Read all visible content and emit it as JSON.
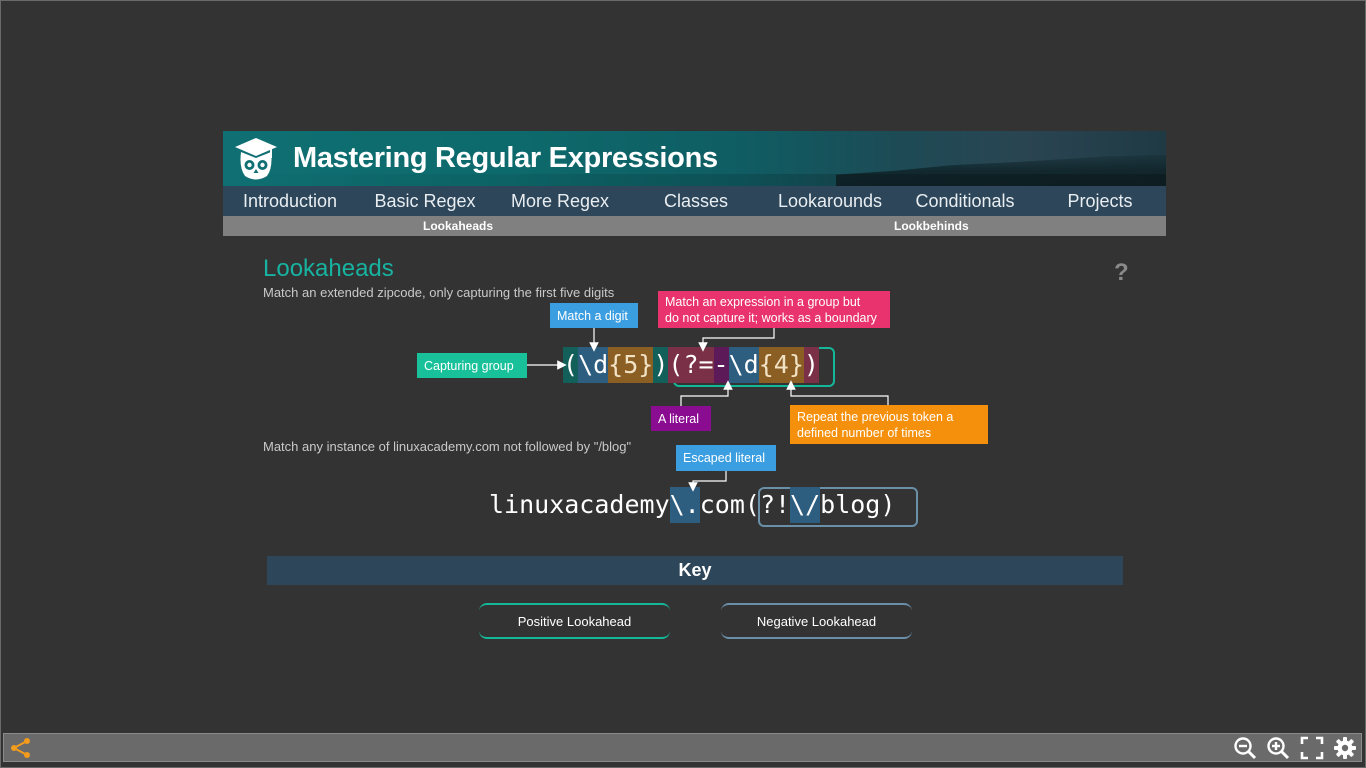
{
  "header": {
    "title": "Mastering Regular Expressions"
  },
  "nav": {
    "items": [
      "Introduction",
      "Basic Regex",
      "More Regex",
      "Classes",
      "Lookarounds",
      "Conditionals",
      "Projects"
    ],
    "sub_items": [
      "Lookaheads",
      "Lookbehinds"
    ]
  },
  "content": {
    "title": "Lookaheads",
    "help": "?",
    "example1": {
      "description": "Match an extended zipcode, only capturing the first five digits",
      "tokens": [
        "(",
        "\\d",
        "{5}",
        ")",
        "(?=",
        "-",
        "\\d",
        "{4}",
        ")"
      ],
      "callouts": {
        "digit": "Match a digit",
        "lookahead_line1": "Match an expression in a group but",
        "lookahead_line2": "do not capture it; works as a boundary",
        "group": "Capturing group",
        "literal": "A literal",
        "repeat_line1": "Repeat the previous token a",
        "repeat_line2": "defined number of times"
      }
    },
    "example2": {
      "description": "Match any instance of linuxacademy.com not followed by \"/blog\"",
      "tokens": [
        "linuxacademy",
        "\\.",
        "com",
        "(?!",
        "\\/",
        "blog)"
      ],
      "callouts": {
        "escaped": "Escaped literal"
      }
    },
    "key": {
      "title": "Key",
      "positive": "Positive Lookahead",
      "negative": "Negative Lookahead"
    }
  },
  "colors": {
    "accent_teal": "#17b3a0",
    "nav_bg": "#2d4659",
    "callout_blue": "#3b9ee0",
    "callout_pink": "#e8336e",
    "callout_green": "#19c19a",
    "callout_purple": "#8a0c91",
    "callout_orange": "#f5900d",
    "toolbar_orange": "#f29b1d"
  },
  "toolbar": {
    "icons": [
      "share-icon",
      "zoom-out-icon",
      "zoom-in-icon",
      "fullscreen-icon",
      "settings-gear-icon"
    ]
  }
}
